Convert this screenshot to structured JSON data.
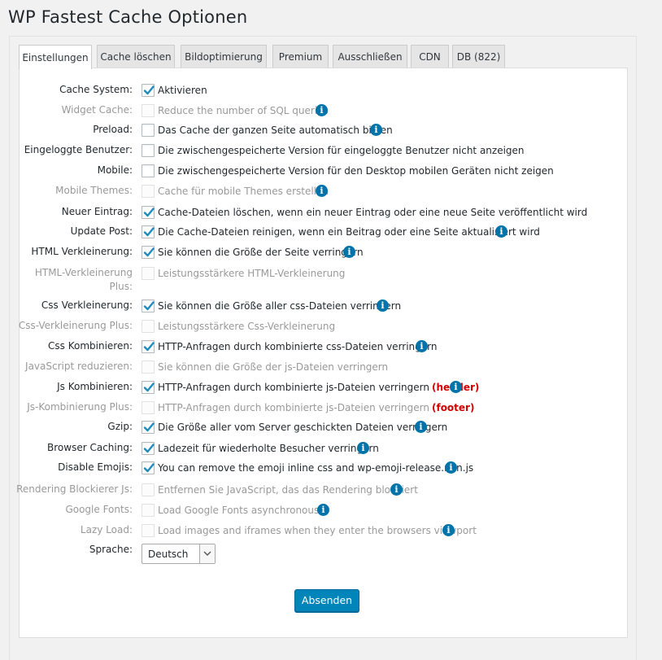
{
  "page": {
    "title": "WP Fastest Cache Optionen"
  },
  "tabs": [
    {
      "label": "Einstellungen"
    },
    {
      "label": "Cache löschen"
    },
    {
      "label": "Bildoptimierung"
    },
    {
      "label": "Premium"
    },
    {
      "label": "Ausschließen"
    },
    {
      "label": "CDN"
    },
    {
      "label": "DB (822)"
    }
  ],
  "settings": [
    {
      "label": "Cache System:",
      "text": "Aktivieren",
      "checked": true,
      "disabled": false
    },
    {
      "label": "Widget Cache:",
      "text": "Reduce the number of SQL queries",
      "checked": false,
      "disabled": true
    },
    {
      "label": "Preload:",
      "text": "Das Cache der ganzen Seite automatisch bilden",
      "checked": false,
      "disabled": false
    },
    {
      "label": "Eingeloggte Benutzer:",
      "text": "Die zwischengespeicherte Version für eingeloggte Benutzer nicht anzeigen",
      "checked": false,
      "disabled": false
    },
    {
      "label": "Mobile:",
      "text": "Die zwischengespeicherte Version für den Desktop mobilen Geräten nicht zeigen",
      "checked": false,
      "disabled": false
    },
    {
      "label": "Mobile Themes:",
      "text": "Cache für mobile Themes erstellen",
      "checked": false,
      "disabled": true
    },
    {
      "label": "Neuer Eintrag:",
      "text": "Cache-Dateien löschen, wenn ein neuer Eintrag oder eine neue Seite veröffentlicht wird",
      "checked": true,
      "disabled": false
    },
    {
      "label": "Update Post:",
      "text": "Die Cache-Dateien reinigen, wenn ein Beitrag oder eine Seite aktualisiert wird",
      "checked": true,
      "disabled": false
    },
    {
      "label": "HTML Verkleinerung:",
      "text": "Sie können die Größe der Seite verringern",
      "checked": true,
      "disabled": false
    },
    {
      "label_line1": "HTML-Verkleinerung",
      "label_line2": "Plus:",
      "text": "Leistungsstärkere HTML-Verkleinerung",
      "checked": false,
      "disabled": true
    },
    {
      "label": "Css Verkleinerung:",
      "text": "Sie können die Größe aller css-Dateien verringern",
      "checked": true,
      "disabled": false
    },
    {
      "label": "Css-Verkleinerung Plus:",
      "text": "Leistungsstärkere Css-Verkleinerung",
      "checked": false,
      "disabled": true
    },
    {
      "label": "Css Kombinieren:",
      "text": "HTTP-Anfragen durch kombinierte css-Dateien verringern",
      "checked": true,
      "disabled": false
    },
    {
      "label": "JavaScript reduzieren:",
      "text": "Sie können die Größe der js-Dateien verringern",
      "checked": false,
      "disabled": true
    },
    {
      "label": "Js Kombinieren:",
      "text": "HTTP-Anfragen durch kombinierte js-Dateien verringern",
      "tag": "(header)",
      "checked": true,
      "disabled": false
    },
    {
      "label": "Js-Kombinierung Plus:",
      "text": "HTTP-Anfragen durch kombinierte js-Dateien verringern",
      "tag": "(footer)",
      "checked": false,
      "disabled": true
    },
    {
      "label": "Gzip:",
      "text": "Die Größe aller vom Server geschickten Dateien verringern",
      "checked": true,
      "disabled": false
    },
    {
      "label": "Browser Caching:",
      "text": "Ladezeit für wiederholte Besucher verringern",
      "checked": true,
      "disabled": false
    },
    {
      "label": "Disable Emojis:",
      "text": "You can remove the emoji inline css and wp-emoji-release.min.js",
      "checked": true,
      "disabled": false
    },
    {
      "label": "Rendering Blockierer Js:",
      "text": "Entfernen Sie JavaScript, das das Rendering blockiert",
      "checked": false,
      "disabled": true
    },
    {
      "label": "Google Fonts:",
      "text": "Load Google Fonts asynchronously",
      "checked": false,
      "disabled": true
    },
    {
      "label": "Lazy Load:",
      "text": "Load images and iframes when they enter the browsers viewport",
      "checked": false,
      "disabled": true
    }
  ],
  "language": {
    "label": "Sprache:",
    "value": "Deutsch"
  },
  "submit": {
    "label": "Absenden"
  },
  "icons": {
    "info": "info-icon",
    "checkmark": "checkmark-icon",
    "dropdown": "chevron-down-icon"
  },
  "colors": {
    "accent": "#0085ba",
    "info": "#0073aa",
    "tag": "#d40000",
    "check": "#1e8cbe"
  }
}
